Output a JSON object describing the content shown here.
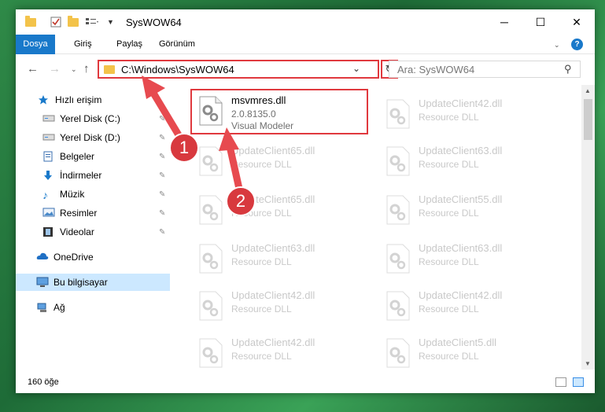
{
  "window": {
    "title": "SysWOW64",
    "controls": {
      "minimize": "─",
      "maximize": "☐",
      "close": "✕"
    }
  },
  "ribbon": {
    "tabs": [
      "Dosya",
      "Giriş",
      "Paylaş",
      "Görünüm"
    ],
    "help": "?"
  },
  "address": {
    "path": "C:\\Windows\\SysWOW64",
    "search_placeholder": "Ara: SysWOW64"
  },
  "sidebar": {
    "quick_access": "Hızlı erişim",
    "items": [
      {
        "label": "Yerel Disk (C:)",
        "pinned": true
      },
      {
        "label": "Yerel Disk (D:)",
        "pinned": true
      },
      {
        "label": "Belgeler",
        "pinned": true
      },
      {
        "label": "İndirmeler",
        "pinned": true
      },
      {
        "label": "Müzik",
        "pinned": true
      },
      {
        "label": "Resimler",
        "pinned": true
      },
      {
        "label": "Videolar",
        "pinned": true
      }
    ],
    "onedrive": "OneDrive",
    "this_pc": "Bu bilgisayar",
    "network": "Ağ"
  },
  "files": {
    "selected": {
      "name": "msvmres.dll",
      "version": "2.0.8135.0",
      "description": "Visual Modeler"
    },
    "left_column": [
      {
        "name": "UpdateClient65.dll",
        "sub": "Resource DLL"
      },
      {
        "name": "UpdateClient65.dll",
        "sub": "Resource DLL"
      },
      {
        "name": "UpdateClient63.dll",
        "sub": "Resource DLL"
      },
      {
        "name": "UpdateClient42.dll",
        "sub": "Resource DLL"
      },
      {
        "name": "UpdateClient42.dll",
        "sub": "Resource DLL"
      }
    ],
    "right_column": [
      {
        "name": "UpdateClient42.dll",
        "sub": "Resource DLL"
      },
      {
        "name": "UpdateClient63.dll",
        "sub": "Resource DLL"
      },
      {
        "name": "UpdateClient55.dll",
        "sub": "Resource DLL"
      },
      {
        "name": "UpdateClient63.dll",
        "sub": "Resource DLL"
      },
      {
        "name": "UpdateClient42.dll",
        "sub": "Resource DLL"
      },
      {
        "name": "UpdateClient5.dll",
        "sub": "Resource DLL"
      }
    ]
  },
  "status": {
    "count": "160 öğe"
  },
  "annotations": {
    "marker1": "1",
    "marker2": "2"
  },
  "colors": {
    "accent": "#1979ca",
    "highlight": "#e0393e",
    "selection": "#cce8ff"
  }
}
